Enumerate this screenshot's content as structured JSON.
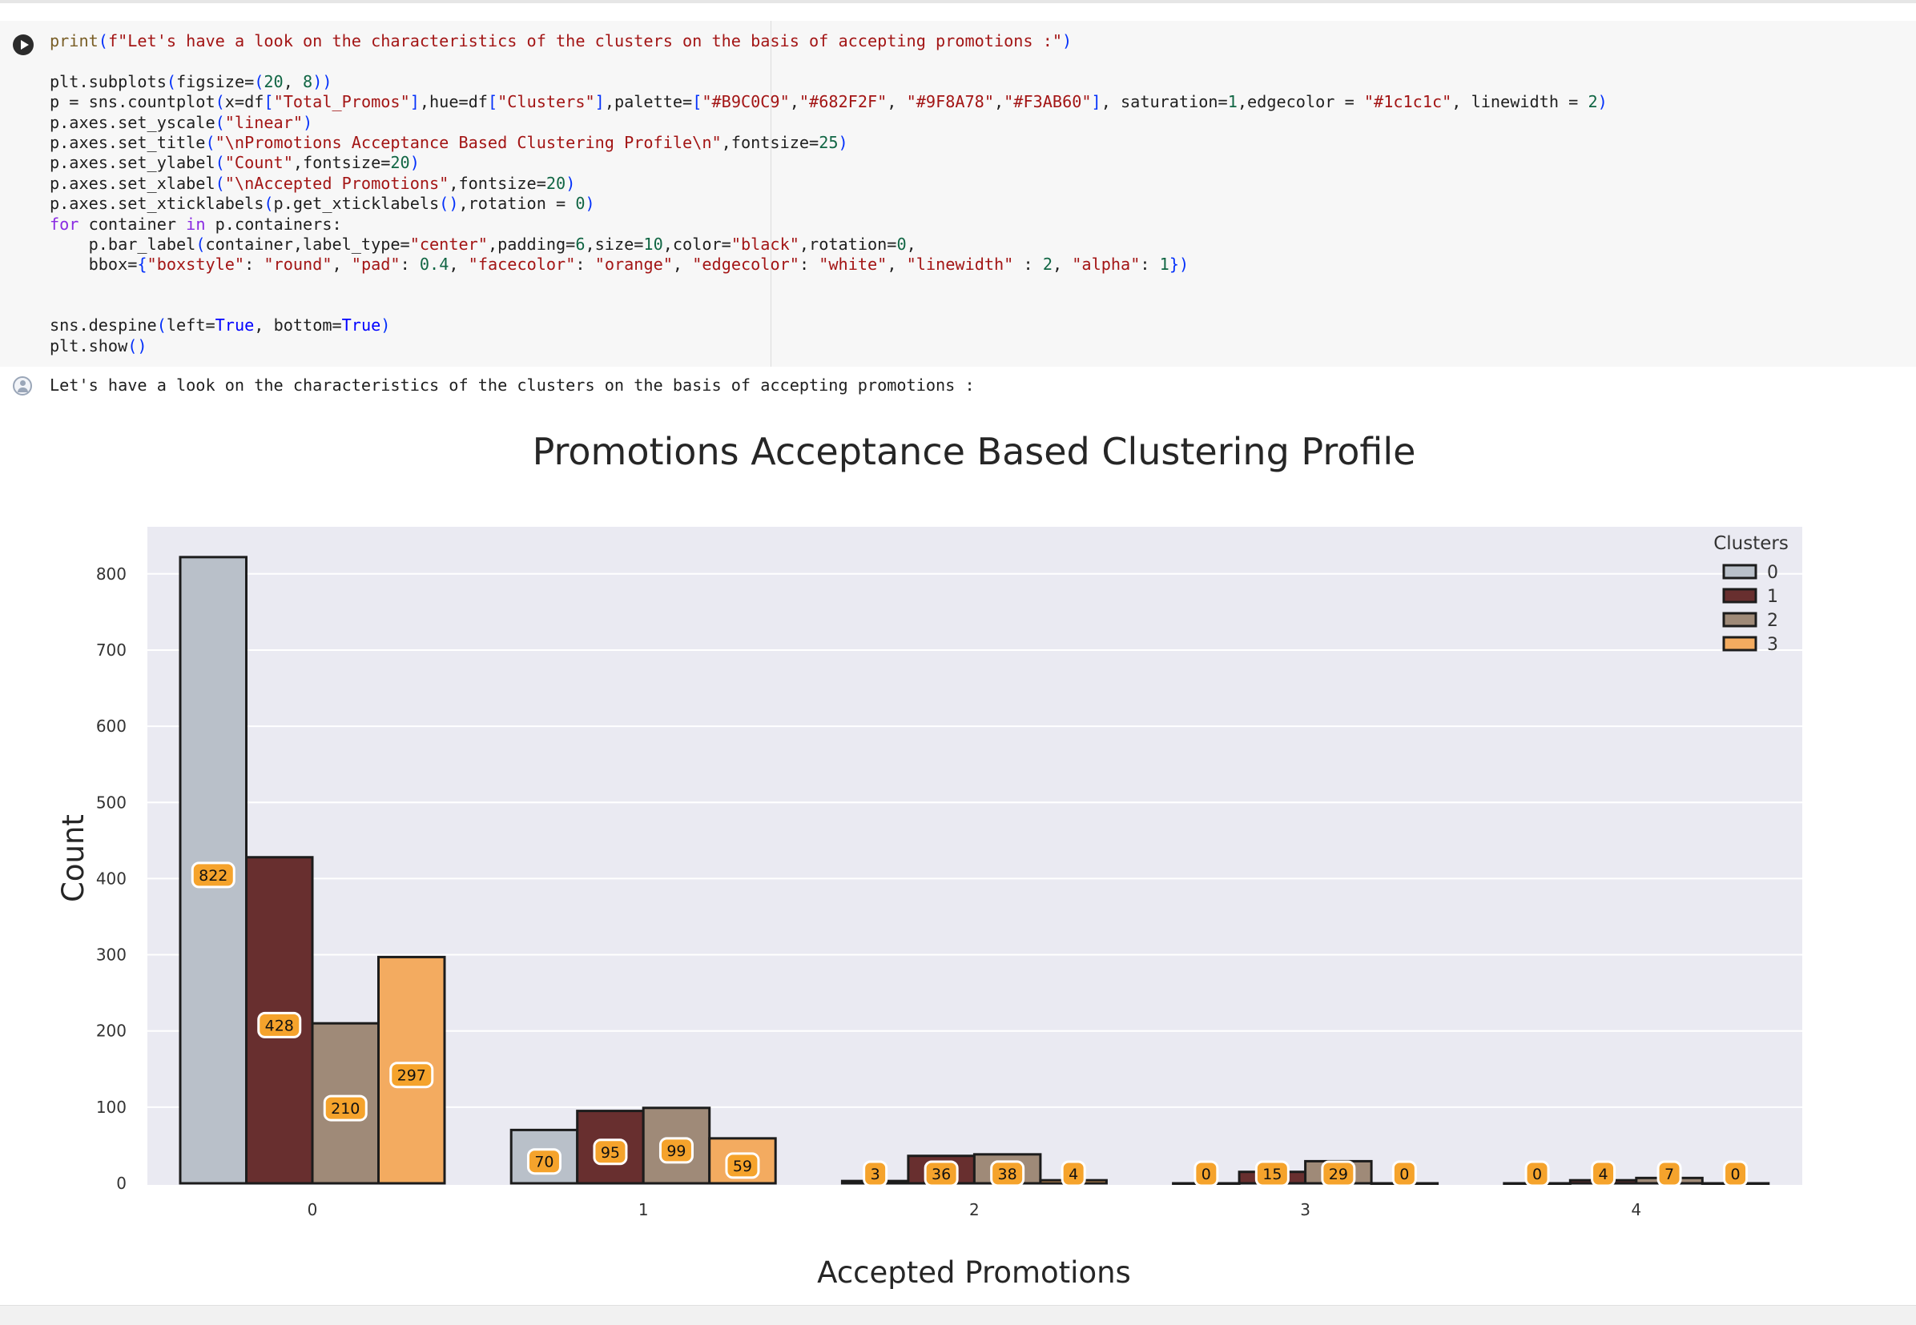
{
  "code_cell": {
    "lines": [
      [
        [
          "fn",
          "print"
        ],
        [
          "paren",
          "("
        ],
        [
          "str",
          "f\"Let's have a look on the characteristics of the clusters on the basis of accepting promotions :\""
        ],
        [
          "paren",
          ")"
        ]
      ],
      [],
      [
        [
          "plain",
          "plt.subplots"
        ],
        [
          "paren",
          "("
        ],
        [
          "plain",
          "figsize="
        ],
        [
          "paren",
          "("
        ],
        [
          "num",
          "20"
        ],
        [
          "plain",
          ", "
        ],
        [
          "num",
          "8"
        ],
        [
          "paren",
          "))"
        ]
      ],
      [
        [
          "plain",
          "p = sns.countplot"
        ],
        [
          "paren",
          "("
        ],
        [
          "plain",
          "x=df"
        ],
        [
          "paren",
          "["
        ],
        [
          "str",
          "\"Total_Promos\""
        ],
        [
          "paren",
          "]"
        ],
        [
          "plain",
          ",hue=df"
        ],
        [
          "paren",
          "["
        ],
        [
          "str",
          "\"Clusters\""
        ],
        [
          "paren",
          "]"
        ],
        [
          "plain",
          ",palette="
        ],
        [
          "paren",
          "["
        ],
        [
          "str",
          "\"#B9C0C9\""
        ],
        [
          "plain",
          ","
        ],
        [
          "str",
          "\"#682F2F\""
        ],
        [
          "plain",
          ", "
        ],
        [
          "str",
          "\"#9F8A78\""
        ],
        [
          "plain",
          ","
        ],
        [
          "str",
          "\"#F3AB60\""
        ],
        [
          "paren",
          "]"
        ],
        [
          "plain",
          ", saturation="
        ],
        [
          "num",
          "1"
        ],
        [
          "plain",
          ",edgecolor = "
        ],
        [
          "str",
          "\"#1c1c1c\""
        ],
        [
          "plain",
          ", linewidth = "
        ],
        [
          "num",
          "2"
        ],
        [
          "paren",
          ")"
        ]
      ],
      [
        [
          "plain",
          "p.axes.set_yscale"
        ],
        [
          "paren",
          "("
        ],
        [
          "str",
          "\"linear\""
        ],
        [
          "paren",
          ")"
        ]
      ],
      [
        [
          "plain",
          "p.axes.set_title"
        ],
        [
          "paren",
          "("
        ],
        [
          "str",
          "\"\\nPromotions Acceptance Based Clustering Profile\\n\""
        ],
        [
          "plain",
          ",fontsize="
        ],
        [
          "num",
          "25"
        ],
        [
          "paren",
          ")"
        ]
      ],
      [
        [
          "plain",
          "p.axes.set_ylabel"
        ],
        [
          "paren",
          "("
        ],
        [
          "str",
          "\"Count\""
        ],
        [
          "plain",
          ",fontsize="
        ],
        [
          "num",
          "20"
        ],
        [
          "paren",
          ")"
        ]
      ],
      [
        [
          "plain",
          "p.axes.set_xlabel"
        ],
        [
          "paren",
          "("
        ],
        [
          "str",
          "\"\\nAccepted Promotions\""
        ],
        [
          "plain",
          ",fontsize="
        ],
        [
          "num",
          "20"
        ],
        [
          "paren",
          ")"
        ]
      ],
      [
        [
          "plain",
          "p.axes.set_xticklabels"
        ],
        [
          "paren",
          "("
        ],
        [
          "plain",
          "p.get_xticklabels"
        ],
        [
          "paren",
          "()"
        ],
        [
          "plain",
          ",rotation = "
        ],
        [
          "num",
          "0"
        ],
        [
          "paren",
          ")"
        ]
      ],
      [
        [
          "kw",
          "for"
        ],
        [
          "plain",
          " container "
        ],
        [
          "kw",
          "in"
        ],
        [
          "plain",
          " p.containers:"
        ]
      ],
      [
        [
          "plain",
          "    p.bar_label"
        ],
        [
          "paren",
          "("
        ],
        [
          "plain",
          "container,label_type="
        ],
        [
          "str",
          "\"center\""
        ],
        [
          "plain",
          ",padding="
        ],
        [
          "num",
          "6"
        ],
        [
          "plain",
          ",size="
        ],
        [
          "num",
          "10"
        ],
        [
          "plain",
          ",color="
        ],
        [
          "str",
          "\"black\""
        ],
        [
          "plain",
          ",rotation="
        ],
        [
          "num",
          "0"
        ],
        [
          "plain",
          ","
        ]
      ],
      [
        [
          "plain",
          "    bbox="
        ],
        [
          "paren",
          "{"
        ],
        [
          "str",
          "\"boxstyle\""
        ],
        [
          "plain",
          ": "
        ],
        [
          "str",
          "\"round\""
        ],
        [
          "plain",
          ", "
        ],
        [
          "str",
          "\"pad\""
        ],
        [
          "plain",
          ": "
        ],
        [
          "num",
          "0.4"
        ],
        [
          "plain",
          ", "
        ],
        [
          "str",
          "\"facecolor\""
        ],
        [
          "plain",
          ": "
        ],
        [
          "str",
          "\"orange\""
        ],
        [
          "plain",
          ", "
        ],
        [
          "str",
          "\"edgecolor\""
        ],
        [
          "plain",
          ": "
        ],
        [
          "str",
          "\"white\""
        ],
        [
          "plain",
          ", "
        ],
        [
          "str",
          "\"linewidth\""
        ],
        [
          "plain",
          " : "
        ],
        [
          "num",
          "2"
        ],
        [
          "plain",
          ", "
        ],
        [
          "str",
          "\"alpha\""
        ],
        [
          "plain",
          ": "
        ],
        [
          "num",
          "1"
        ],
        [
          "paren",
          "})"
        ]
      ],
      [],
      [],
      [
        [
          "plain",
          "sns.despine"
        ],
        [
          "paren",
          "("
        ],
        [
          "plain",
          "left="
        ],
        [
          "const",
          "True"
        ],
        [
          "plain",
          ", bottom="
        ],
        [
          "const",
          "True"
        ],
        [
          "paren",
          ")"
        ]
      ],
      [
        [
          "plain",
          "plt.show"
        ],
        [
          "paren",
          "()"
        ]
      ]
    ]
  },
  "stdout_text": "Let's have a look on the characteristics of the clusters on the basis of accepting promotions :",
  "chart_data": {
    "type": "bar",
    "title": "Promotions Acceptance Based Clustering Profile",
    "xlabel": "Accepted Promotions",
    "ylabel": "Count",
    "categories": [
      "0",
      "1",
      "2",
      "3",
      "4"
    ],
    "ylim": [
      0,
      840
    ],
    "yticks": [
      0,
      100,
      200,
      300,
      400,
      500,
      600,
      700,
      800
    ],
    "grid": true,
    "legend": {
      "title": "Clusters",
      "placement": "top-right"
    },
    "series": [
      {
        "name": "0",
        "color": "#B9C0C9",
        "values": [
          822,
          70,
          3,
          0,
          0
        ]
      },
      {
        "name": "1",
        "color": "#682F2F",
        "values": [
          428,
          95,
          36,
          15,
          4
        ]
      },
      {
        "name": "2",
        "color": "#9F8A78",
        "values": [
          210,
          99,
          38,
          29,
          7
        ]
      },
      {
        "name": "3",
        "color": "#F3AB60",
        "values": [
          297,
          59,
          4,
          0,
          0
        ]
      }
    ],
    "edgecolor": "#1c1c1c",
    "label_box_color": "#F5A32C",
    "plot_background": "#EAEAF2"
  }
}
